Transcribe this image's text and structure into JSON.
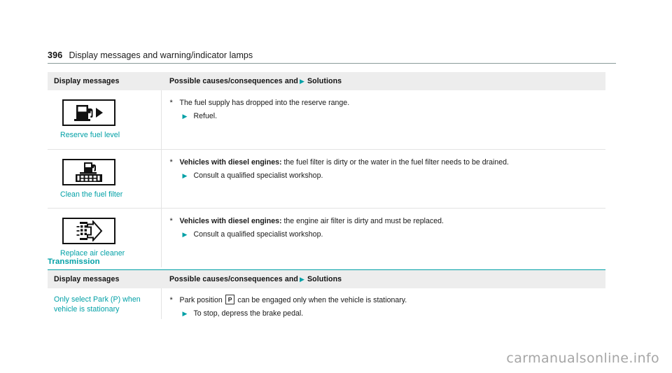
{
  "page": {
    "number": "396",
    "title": "Display messages and warning/indicator lamps",
    "watermark": "carmanualsonline.info"
  },
  "columns": {
    "display_messages": "Display messages",
    "causes_prefix": "Possible causes/consequences and",
    "causes_suffix": "Solutions",
    "arrow_glyph": "▶"
  },
  "tables": [
    {
      "section": null,
      "rows": [
        {
          "icon": "fuel-pump-arrow-icon",
          "message": "Reserve fuel level",
          "cause_bold": "",
          "cause_text": "The fuel supply has dropped into the reserve range.",
          "solution": "Refuel."
        },
        {
          "icon": "fuel-filter-icon",
          "message": "Clean the fuel filter",
          "cause_bold": "Vehicles with diesel engines:",
          "cause_text": "the fuel filter is dirty or the water in the fuel filter needs to be drained.",
          "solution": "Consult a qualified specialist workshop."
        },
        {
          "icon": "air-cleaner-arrow-icon",
          "message": "Replace air cleaner",
          "cause_bold": "Vehicles with diesel engines:",
          "cause_text": "the engine air filter is dirty and must be replaced.",
          "solution": "Consult a qualified specialist workshop."
        }
      ]
    },
    {
      "section": "Transmission",
      "rows": [
        {
          "icon": null,
          "message": "Only select Park (P) when vehicle is stationary",
          "cause_bold": "",
          "cause_pre": "Park position",
          "cause_badge": "P",
          "cause_post": "can be engaged only when the vehicle is stationary.",
          "solution": "To stop, depress the brake pedal."
        }
      ]
    }
  ],
  "colors": {
    "accent": "#00a0a6",
    "header_band": "#ededed",
    "rule": "#8a9a99",
    "border": "#e3e3e3"
  }
}
